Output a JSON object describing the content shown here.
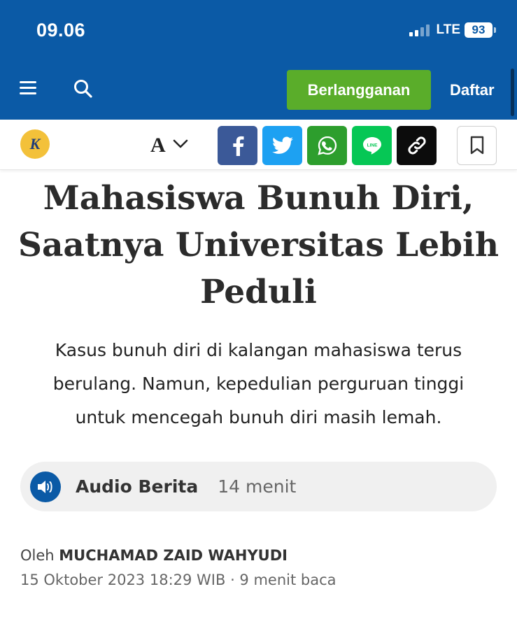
{
  "status_bar": {
    "time": "09.06",
    "network": "LTE",
    "battery": "93"
  },
  "header": {
    "subscribe_label": "Berlangganan",
    "register_label": "Daftar"
  },
  "toolbar": {
    "logo_letter": "K",
    "font_size_letter": "A"
  },
  "article": {
    "title": "Mahasiswa Bunuh Diri, Saatnya Universitas Lebih Peduli",
    "subtitle": "Kasus bunuh diri di kalangan mahasiswa terus berulang. Namun, kepedulian perguruan tinggi untuk mencegah bunuh diri masih lemah.",
    "audio": {
      "label": "Audio Berita",
      "duration": "14 menit"
    },
    "byline_prefix": "Oleh",
    "author": "MUCHAMAD ZAID WAHYUDI",
    "meta": "15 Oktober 2023 18:29 WIB · 9 menit baca"
  },
  "colors": {
    "header_blue": "#0b5aa6",
    "subscribe_green": "#5aad2a",
    "facebook": "#3b5998",
    "twitter": "#1da1f2",
    "whatsapp": "#2d9e2d",
    "line": "#06c755",
    "copy_link": "#0c0c0c"
  },
  "icons": [
    "menu-icon",
    "search-icon",
    "facebook-icon",
    "twitter-icon",
    "whatsapp-icon",
    "line-icon",
    "link-icon",
    "bookmark-icon",
    "speaker-icon",
    "chevron-down-icon",
    "signal-icon",
    "battery-icon"
  ]
}
